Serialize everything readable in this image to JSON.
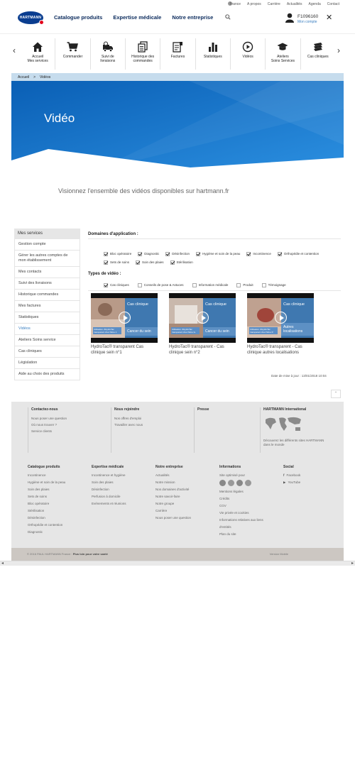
{
  "topbar": {
    "links": [
      "France",
      "A propos",
      "Carrière",
      "Actualités",
      "Agenda",
      "Contact"
    ]
  },
  "logo": {
    "text": "HARTMANN"
  },
  "nav": [
    "Catalogue produits",
    "Expertise médicale",
    "Notre entreprise"
  ],
  "user": {
    "id": "F1096160",
    "link": "Mon compte"
  },
  "quicknav": [
    {
      "label": "Accueil\nMes services",
      "icon": "home-icon"
    },
    {
      "label": "Commander",
      "icon": "cart-icon"
    },
    {
      "label": "Suivi de\nlivraisons",
      "icon": "delivery-icon"
    },
    {
      "label": "Historique des\ncommandes",
      "icon": "documents-icon"
    },
    {
      "label": "Factures",
      "icon": "invoice-icon"
    },
    {
      "label": "Statistiques",
      "icon": "bar-chart-icon"
    },
    {
      "label": "Vidéos",
      "icon": "play-icon"
    },
    {
      "label": "Ateliers\nSoins Services",
      "icon": "graduation-cap-icon"
    },
    {
      "label": "Cas cliniques",
      "icon": "stack-icon"
    }
  ],
  "breadcrumb": {
    "home": "Accueil",
    "sep": ">",
    "current": "Vidéos"
  },
  "hero": {
    "title": "Vidéo"
  },
  "subtitle": "Visionnez l'ensemble des vidéos disponibles sur hartmann.fr",
  "sidebar": {
    "head": "Mes services",
    "items": [
      "Gestion compte",
      "Gérer les autres comptes de mon établissement",
      "Mes contacts",
      "Suivi des livraisons",
      "Historique commandes",
      "Mes factures",
      "Statistiques",
      "Vidéos",
      "Ateliers Soins service",
      "Cas cliniques",
      "Législation",
      "Aide au choix des produits"
    ],
    "active_index": 7
  },
  "filters": {
    "domains_title": "Domaines d'application :",
    "domains": [
      {
        "label": "Bloc opératoire",
        "checked": true
      },
      {
        "label": "Diagnostic",
        "checked": true
      },
      {
        "label": "Désinfection",
        "checked": true
      },
      {
        "label": "Hygiène et soin de la peau",
        "checked": true
      },
      {
        "label": "Incontinence",
        "checked": true
      },
      {
        "label": "Orthopédie et contention",
        "checked": true
      },
      {
        "label": "Sets de soins",
        "checked": true
      },
      {
        "label": "Soin des plaies",
        "checked": true
      },
      {
        "label": "Stérilisation",
        "checked": true
      }
    ],
    "types_title": "Types de vidéo :",
    "types": [
      {
        "label": "Cas cliniques",
        "checked": true
      },
      {
        "label": "Conseils de pose & Astuces",
        "checked": false
      },
      {
        "label": "Information médicale",
        "checked": false
      },
      {
        "label": "Produit",
        "checked": false
      },
      {
        "label": "Témoignage",
        "checked": false
      }
    ]
  },
  "videos": [
    {
      "title": "HydroTac® transparent Cas clinique sein n°1",
      "tag": "Cas clinique",
      "tag2": "Cancer du sein",
      "overlay": "Utilisation d'HydroTac transparent chez Mme J."
    },
    {
      "title": "HydroTac® transparent - Cas clinique sein n°2",
      "tag": "Cas clinique",
      "tag2": "Cancer du sein",
      "overlay": "Utilisation d'HydroTac transparent chez Mme G."
    },
    {
      "title": "HydroTac® transparent - Cas clinique autres localisations",
      "tag": "Cas clinique",
      "tag2": "Autres localisations",
      "overlay": "Utilisation d'HydroTac transparent chez Mme P."
    }
  ],
  "updated": "Date de mise à jour : 13/01/2018 10:04",
  "footer": {
    "contact": {
      "title": "Contactez-nous",
      "items": [
        "Nous poser une question",
        "Où nous trouver ?",
        "Service clients"
      ]
    },
    "join": {
      "title": "Nous rejoindre",
      "items": [
        "Nos offres d'emploi",
        "Travailler avec nous"
      ]
    },
    "press": {
      "title": "Presse"
    },
    "intl": {
      "title": "HARTMANN International",
      "text": "Découvrez les différents sites HARTMANN dans le monde"
    },
    "cols": [
      {
        "title": "Catalogue produits",
        "items": [
          "Incontinence",
          "Hygiène et soin de la peau",
          "Soin des plaies",
          "Sets de soins",
          "Bloc opératoire",
          "Stérilisation",
          "Désinfection",
          "Orthopédie et contention",
          "Diagnostic"
        ]
      },
      {
        "title": "Expertise médicale",
        "items": [
          "Incontinence et hygiène",
          "Soin des plaies",
          "Désinfection",
          "Perfusion à domicile",
          "Evénements et réunions"
        ]
      },
      {
        "title": "Notre entreprise",
        "items": [
          "Actualités",
          "Notre mission",
          "Nos domaines d'activité",
          "Notre savoir-faire",
          "Notre groupe",
          "Carrière",
          "Nous poser une question"
        ]
      },
      {
        "title": "Informations",
        "items": [
          "Site optimisé pour",
          "Mentions légales",
          "Crédits",
          "CGV",
          "Vie privée et cookies",
          "Informations relatives aux liens",
          "d'entités",
          "Plan du site"
        ]
      },
      {
        "title": "Social",
        "items": [
          "Facebook",
          "YouTube"
        ]
      }
    ],
    "legal": "© 2016 PAUL HARTMANN France :",
    "legal_bold": "Plus loin pour votre santé",
    "mobile": "Version Mobile"
  }
}
